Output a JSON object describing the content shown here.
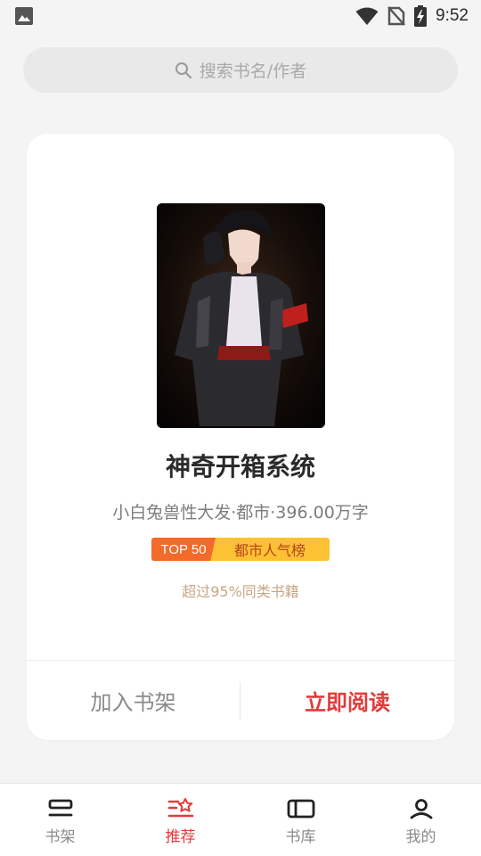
{
  "status_bar": {
    "time": "9:52",
    "icons": [
      "image-icon",
      "wifi-icon",
      "no-sim-icon",
      "battery-charging-icon"
    ]
  },
  "search": {
    "placeholder": "搜索书名/作者",
    "icon": "search-icon"
  },
  "book": {
    "title": "神奇开箱系统",
    "meta": "小白兔兽性大发·都市·396.00万字",
    "rank_top": "TOP 50",
    "rank_list": "都市人气榜",
    "rank_desc": "超过95%同类书籍"
  },
  "actions": {
    "add_shelf": "加入书架",
    "read_now": "立即阅读"
  },
  "nav": {
    "items": [
      {
        "label": "书架",
        "icon": "bookshelf-icon"
      },
      {
        "label": "推荐",
        "icon": "recommend-icon",
        "active": true
      },
      {
        "label": "书库",
        "icon": "library-icon"
      },
      {
        "label": "我的",
        "icon": "profile-icon"
      }
    ]
  },
  "colors": {
    "accent": "#e33a3a",
    "rank_top_bg": "#f46a2b",
    "rank_list_bg": "#fdc233",
    "background": "#f4f4f4"
  }
}
